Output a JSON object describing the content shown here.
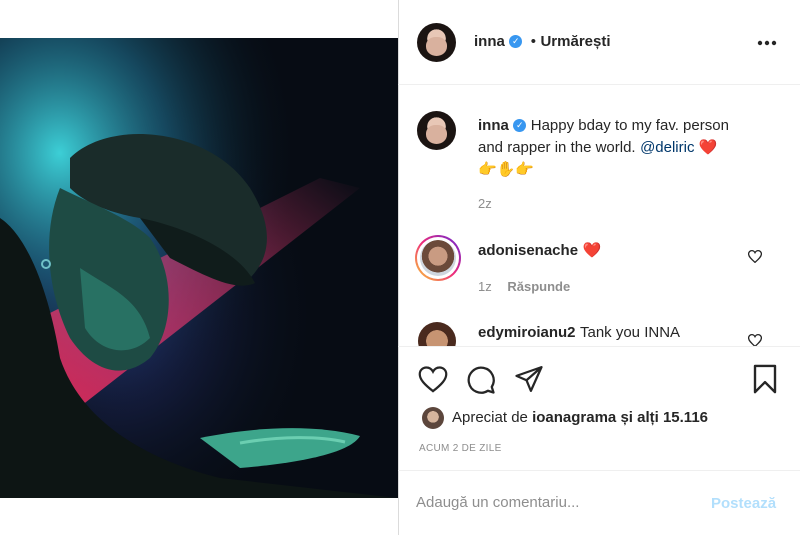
{
  "header": {
    "username": "inna",
    "follow_separator": "•",
    "follow_label": "Urmărești",
    "more_icon": "ellipsis-icon"
  },
  "caption": {
    "username": "inna",
    "text_line1": "Happy bday to my fav. person",
    "text_line2": "and rapper in the world.",
    "mention": "@deliric",
    "heart": "❤️",
    "emoji_line": "👉✋👉",
    "time": "2z"
  },
  "comments": [
    {
      "username": "adonisenache",
      "text": "❤️",
      "time": "1z",
      "reply_label": "Răspunde"
    },
    {
      "username": "edymiroianu2",
      "text": "Tank you INNA"
    }
  ],
  "actions": {
    "like_icon": "heart-outline-icon",
    "comment_icon": "comment-icon",
    "share_icon": "paper-plane-icon",
    "save_icon": "bookmark-icon"
  },
  "likes": {
    "prefix": "Apreciat de",
    "user": "ioanagrama",
    "suffix": "și alți 15.116"
  },
  "timestamp": "ACUM 2 DE ZILE",
  "comment_box": {
    "placeholder": "Adaugă un comentariu...",
    "post_label": "Postează"
  },
  "colors": {
    "verified": "#3897f0",
    "post_button": "#b2dffc",
    "heart": "#ed4956",
    "top_button": "#ed4956"
  }
}
